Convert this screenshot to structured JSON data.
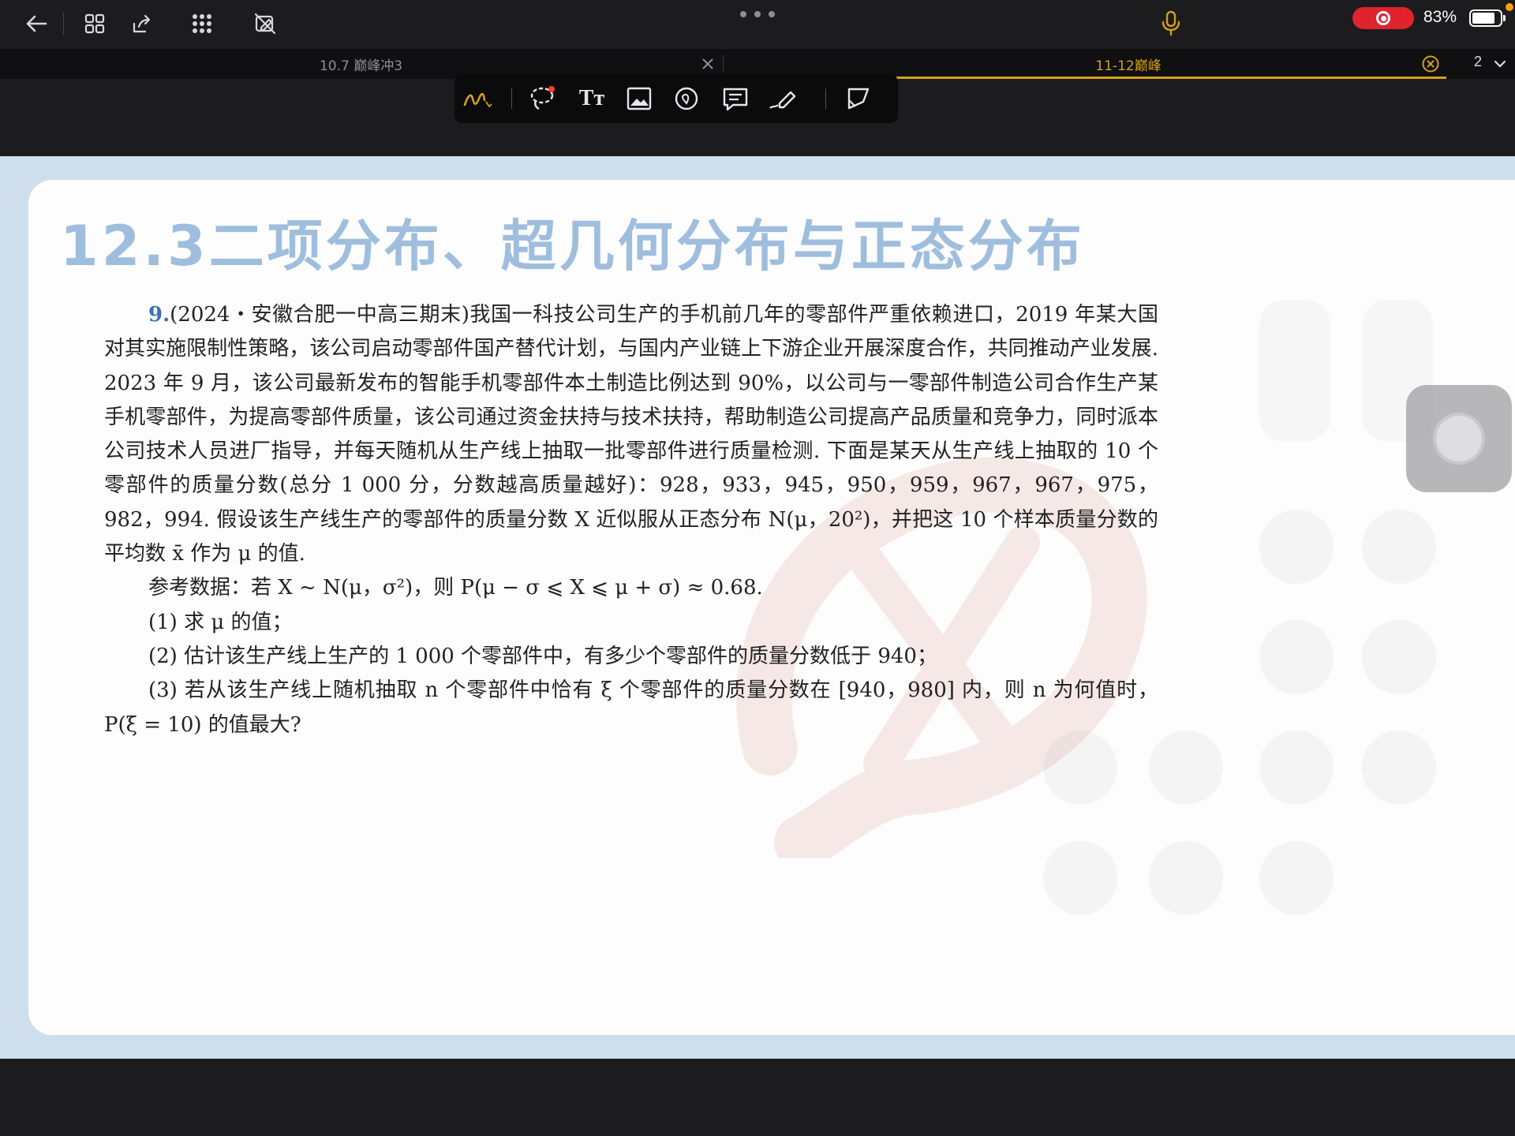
{
  "status_bar": {
    "battery_percent": "83%",
    "recording": true
  },
  "tabs": [
    {
      "label": "10.7 巅峰冲3",
      "active": false
    },
    {
      "label": "11-12巅峰",
      "active": true
    }
  ],
  "tab_count": "2",
  "toolbar": {
    "tools": [
      "pen-tool",
      "lasso-tool",
      "text-tool",
      "image-tool",
      "sticker-tool",
      "comment-tool",
      "highlighter-tool",
      "crop-tool"
    ],
    "text_tool_label": "Tт"
  },
  "document": {
    "chapter_title": "12.3二项分布、超几何分布与正态分布",
    "question_number": "9.",
    "paragraph1": "(2024・安徽合肥一中高三期末)我国一科技公司生产的手机前几年的零部件严重依赖进口，2019 年某大国对其实施限制性策略，该公司启动零部件国产替代计划，与国内产业链上下游企业开展深度合作，共同推动产业发展. 2023 年 9 月，该公司最新发布的智能手机零部件本土制造比例达到 90%，以公司与一零部件制造公司合作生产某手机零部件，为提高零部件质量，该公司通过资金扶持与技术扶持，帮助制造公司提高产品质量和竞争力，同时派本公司技术人员进厂指导，并每天随机从生产线上抽取一批零部件进行质量检测. 下面是某天从生产线上抽取的 10 个零部件的质量分数(总分 1 000 分，分数越高质量越好)：928，933，945，950，959，967，967，975，982，994. 假设该生产线生产的零部件的质量分数 X 近似服从正态分布 N(μ，20²)，并把这 10 个样本质量分数的平均数 x̄ 作为 μ 的值.",
    "reference": "参考数据：若 X ~ N(μ，σ²)，则 P(μ − σ ⩽ X ⩽ μ + σ) ≈ 0.68.",
    "q1": "(1) 求 μ 的值；",
    "q2": "(2) 估计该生产线上生产的 1 000 个零部件中，有多少个零部件的质量分数低于 940；",
    "q3": "(3) 若从该生产线上随机抽取 n 个零部件中恰有 ξ 个零部件的质量分数在 [940，980] 内，则 n 为何值时，P(ξ = 10) 的值最大?"
  },
  "colors": {
    "accent_tab": "#d4a017",
    "title_blue": "#9fbede",
    "record_red": "#e0232e",
    "viewer_bg": "#cfdeec"
  }
}
